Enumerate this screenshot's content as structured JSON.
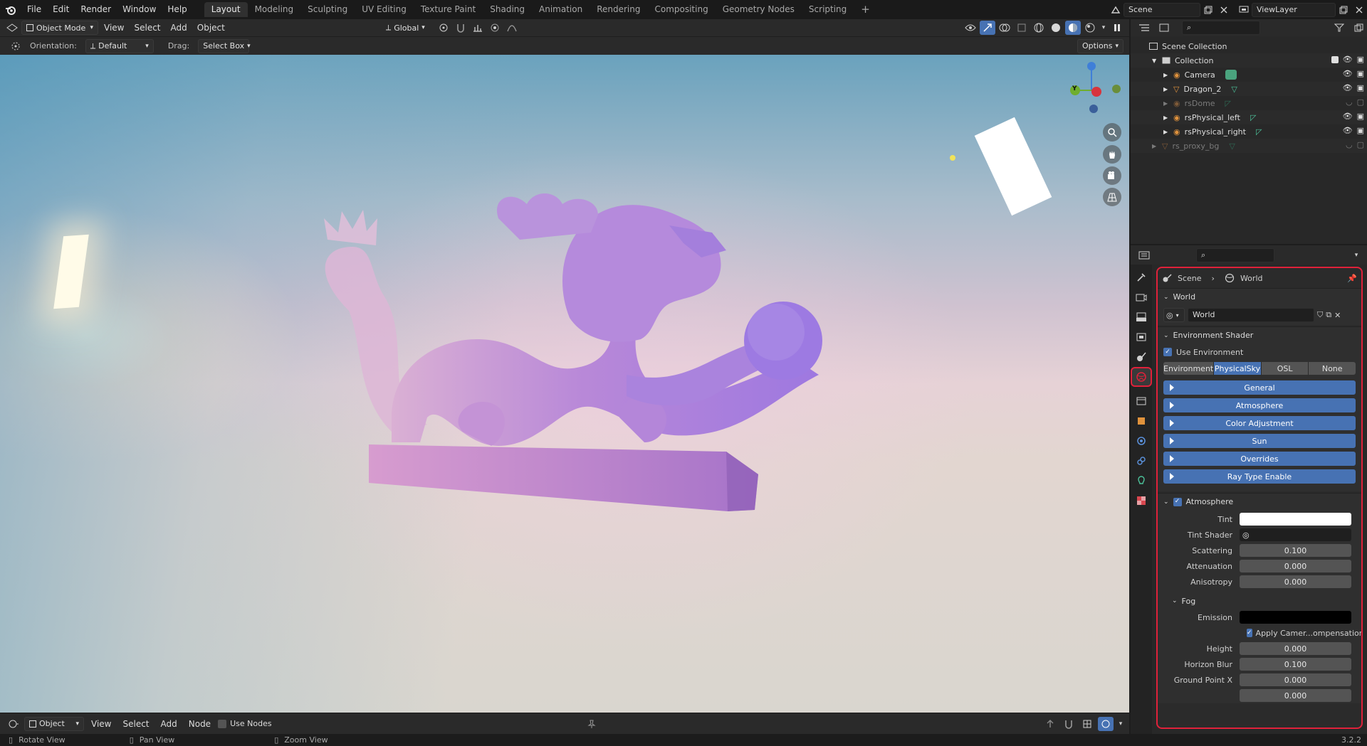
{
  "topbar": {
    "menus": [
      "File",
      "Edit",
      "Render",
      "Window",
      "Help"
    ],
    "workspaces": [
      "Layout",
      "Modeling",
      "Sculpting",
      "UV Editing",
      "Texture Paint",
      "Shading",
      "Animation",
      "Rendering",
      "Compositing",
      "Geometry Nodes",
      "Scripting"
    ],
    "active_workspace": "Layout",
    "add_tab": "+",
    "scene": "Scene",
    "view_layer": "ViewLayer"
  },
  "viewport_header": {
    "mode": "Object Mode",
    "menus": [
      "View",
      "Select",
      "Add",
      "Object"
    ],
    "transform_orientation": "Global"
  },
  "tool_settings": {
    "orientation_label": "Orientation:",
    "orientation_value": "Default",
    "drag_label": "Drag:",
    "drag_value": "Select Box",
    "options": "Options"
  },
  "gizmo": {
    "y_label": "Y"
  },
  "node_header": {
    "mode": "Object",
    "menus": [
      "View",
      "Select",
      "Add",
      "Node"
    ],
    "use_nodes": "Use Nodes"
  },
  "statusbar": {
    "rotate": "Rotate View",
    "pan": "Pan View",
    "zoom": "Zoom View",
    "version": "3.2.2"
  },
  "outliner": {
    "root": "Scene Collection",
    "collection": "Collection",
    "items": [
      {
        "name": "Camera",
        "dim": false
      },
      {
        "name": "Dragon_2",
        "dim": false
      },
      {
        "name": "rsDome",
        "dim": true
      },
      {
        "name": "rsPhysical_left",
        "dim": false
      },
      {
        "name": "rsPhysical_right",
        "dim": false
      }
    ],
    "proxy": "rs_proxy_bg"
  },
  "properties": {
    "breadcrumb_scene": "Scene",
    "breadcrumb_world": "World",
    "world_panel": "World",
    "world_name": "World",
    "env_shader_panel": "Environment Shader",
    "use_environment": "Use Environment",
    "shader_options": [
      "Environment",
      "PhysicalSky",
      "OSL",
      "None"
    ],
    "active_shader": "PhysicalSky",
    "subpanels": [
      "General",
      "Atmosphere",
      "Color Adjustment",
      "Sun",
      "Overrides",
      "Ray Type Enable"
    ],
    "atmosphere_panel": "Atmosphere",
    "tint_label": "Tint",
    "tint_shader_label": "Tint Shader",
    "scattering_label": "Scattering",
    "scattering": "0.100",
    "attenuation_label": "Attenuation",
    "attenuation": "0.000",
    "anisotropy_label": "Anisotropy",
    "anisotropy": "0.000",
    "fog_panel": "Fog",
    "emission_label": "Emission",
    "apply_camera": "Apply Camer...ompensation",
    "height_label": "Height",
    "height": "0.000",
    "horizon_blur_label": "Horizon Blur",
    "horizon_blur": "0.100",
    "ground_x_label": "Ground Point X",
    "ground_x": "0.000",
    "ground_y": "0.000"
  },
  "colors": {
    "accent_blue": "#4772b3",
    "highlight_red": "#e0213a",
    "dragon": "#a77fd6"
  }
}
